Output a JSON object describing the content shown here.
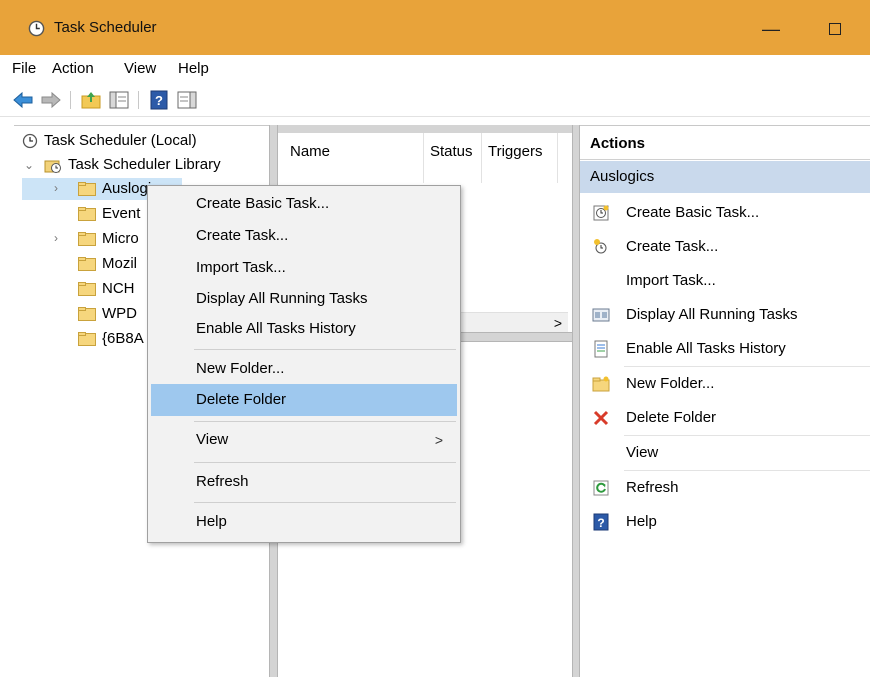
{
  "window": {
    "title": "Task Scheduler",
    "minimize": "—"
  },
  "menubar": {
    "items": [
      "File",
      "Action",
      "View",
      "Help"
    ]
  },
  "colors": {
    "titlebar": "#e8a33a",
    "selection": "#9ec8ee",
    "section": "#c9d9ec",
    "delete_x": "#d83b2a"
  },
  "toolbar": {
    "icons": [
      "back-arrow-icon",
      "forward-arrow-icon",
      "folder-up-icon",
      "show-hide-tree-icon",
      "help-icon",
      "show-action-pane-icon"
    ]
  },
  "tree": {
    "root": "Task Scheduler (Local)",
    "library": "Task Scheduler Library",
    "folders": [
      "Auslogics",
      "Event",
      "Micro",
      "Mozil",
      "NCH",
      "WPD",
      "{6B8A"
    ]
  },
  "center": {
    "columns": [
      "Name",
      "Status",
      "Triggers"
    ],
    "scroll_right": ">"
  },
  "actions": {
    "header": "Actions",
    "section": "Auslogics",
    "items": [
      "Create Basic Task...",
      "Create Task...",
      "Import Task...",
      "Display All Running Tasks",
      "Enable All Tasks History",
      "New Folder...",
      "Delete Folder",
      "View",
      "Refresh",
      "Help"
    ]
  },
  "context_menu": {
    "items": [
      "Create Basic Task...",
      "Create Task...",
      "Import Task...",
      "Display All Running Tasks",
      "Enable All Tasks History",
      "New Folder...",
      "Delete Folder",
      "View",
      "Refresh",
      "Help"
    ],
    "highlighted": "Delete Folder",
    "submenu_arrow": ">"
  }
}
